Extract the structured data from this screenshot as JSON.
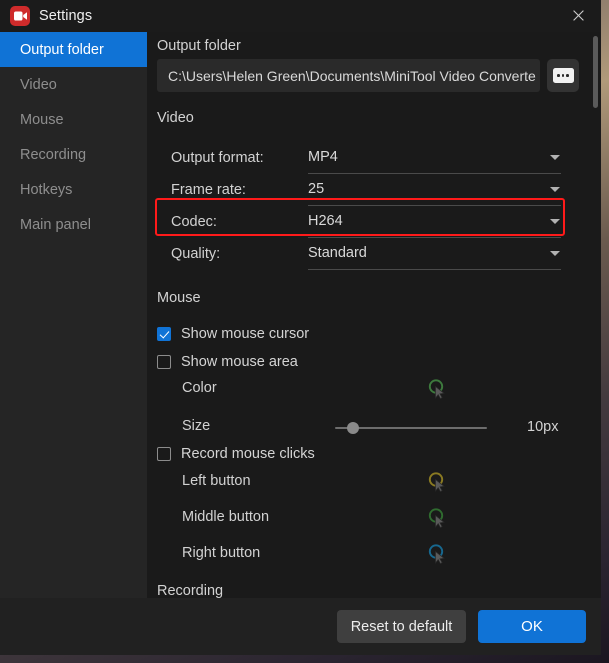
{
  "window": {
    "title": "Settings",
    "logo_icon": "video-camera-icon",
    "close_icon": "close-icon"
  },
  "sidebar": {
    "items": [
      {
        "label": "Output folder",
        "active": true
      },
      {
        "label": "Video",
        "active": false
      },
      {
        "label": "Mouse",
        "active": false
      },
      {
        "label": "Recording",
        "active": false
      },
      {
        "label": "Hotkeys",
        "active": false
      },
      {
        "label": "Main panel",
        "active": false
      }
    ]
  },
  "output_folder": {
    "heading": "Output folder",
    "path": "C:\\Users\\Helen Green\\Documents\\MiniTool Video Converte",
    "browse_icon": "ellipsis-icon"
  },
  "video": {
    "heading": "Video",
    "fields": [
      {
        "label": "Output format:",
        "value": "MP4",
        "highlighted": false
      },
      {
        "label": "Frame rate:",
        "value": "25",
        "highlighted": true
      },
      {
        "label": "Codec:",
        "value": "H264",
        "highlighted": false
      },
      {
        "label": "Quality:",
        "value": "Standard",
        "highlighted": false
      }
    ],
    "caret_icon": "chevron-down-icon"
  },
  "mouse": {
    "heading": "Mouse",
    "show_cursor": {
      "label": "Show mouse cursor",
      "checked": true
    },
    "show_area": {
      "label": "Show mouse area",
      "checked": false
    },
    "color": {
      "label": "Color",
      "swatch": "#3d7a3d",
      "icon": "cursor-color-icon"
    },
    "size": {
      "label": "Size",
      "value": "10px",
      "percent": 9
    },
    "record_clicks": {
      "label": "Record mouse clicks",
      "checked": false
    },
    "buttons": [
      {
        "label": "Left button",
        "swatch": "#8a7a22",
        "icon": "cursor-color-icon"
      },
      {
        "label": "Middle button",
        "swatch": "#2f6b2f",
        "icon": "cursor-color-icon"
      },
      {
        "label": "Right button",
        "swatch": "#17688f",
        "icon": "cursor-color-icon"
      }
    ]
  },
  "recording": {
    "heading": "Recording"
  },
  "footer": {
    "reset_label": "Reset to default",
    "ok_label": "OK"
  },
  "colors": {
    "accent": "#1073d6",
    "highlight": "#ff1a1a",
    "window_bg": "#1a1a1a",
    "sidebar_bg": "#252525"
  }
}
